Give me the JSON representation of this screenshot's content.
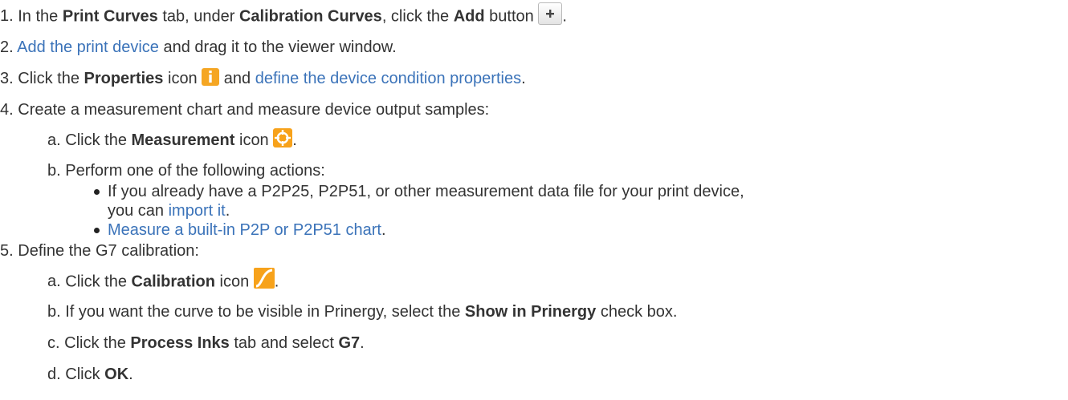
{
  "steps": [
    {
      "num": "1.",
      "pre": "In the ",
      "b1": "Print Curves",
      "mid": " tab, under ",
      "b2": "Calibration Curves",
      "mid2": ", click the ",
      "b3": "Add",
      "post": " button",
      "end": "."
    },
    {
      "num": "2.",
      "link": "Add the print device",
      "post": " and drag it to the viewer window."
    },
    {
      "num": "3.",
      "pre": "Click the ",
      "b1": "Properties",
      "post": " icon",
      "mid": " and ",
      "link": "define the device condition properties",
      "end": "."
    },
    {
      "num": "4.",
      "text": "Create a measurement chart and measure device output samples:"
    },
    {
      "num": "5.",
      "text": "Define the G7 calibration:"
    }
  ],
  "step4": {
    "a": {
      "num": "a.",
      "pre": "Click the ",
      "b1": "Measurement",
      "post": " icon",
      "end": "."
    },
    "b": {
      "num": "b.",
      "text": "Perform one of the following actions:"
    },
    "bullet1": {
      "line1": "If you already have a P2P25, P2P51, or other measurement data file for your print device,",
      "pre2": "you can ",
      "link": "import it",
      "end": "."
    },
    "bullet2": {
      "link": "Measure a built-in P2P or P2P51 chart",
      "end": "."
    }
  },
  "step5": {
    "a": {
      "num": "a.",
      "pre": "Click the ",
      "b1": "Calibration",
      "post": " icon",
      "end": "."
    },
    "b": {
      "num": "b.",
      "pre": "If you want the curve to be visible in Prinergy, select the ",
      "b1": "Show in Prinergy",
      "post": " check box."
    },
    "c": {
      "num": "c.",
      "pre": "Click the ",
      "b1": "Process Inks",
      "mid": " tab and select ",
      "b2": "G7",
      "end": "."
    },
    "d": {
      "num": "d.",
      "pre": "Click ",
      "b1": "OK",
      "end": "."
    }
  },
  "icons": {
    "add": "plus-icon",
    "properties": "info-icon",
    "measurement": "crosshair-target-icon",
    "calibration": "curve-icon"
  },
  "colors": {
    "text": "#333333",
    "link": "#3b73b9",
    "properties_icon": "#f5a623",
    "measurement_icon": "#f7a21b",
    "calibration_icon": "#f7a21b"
  }
}
